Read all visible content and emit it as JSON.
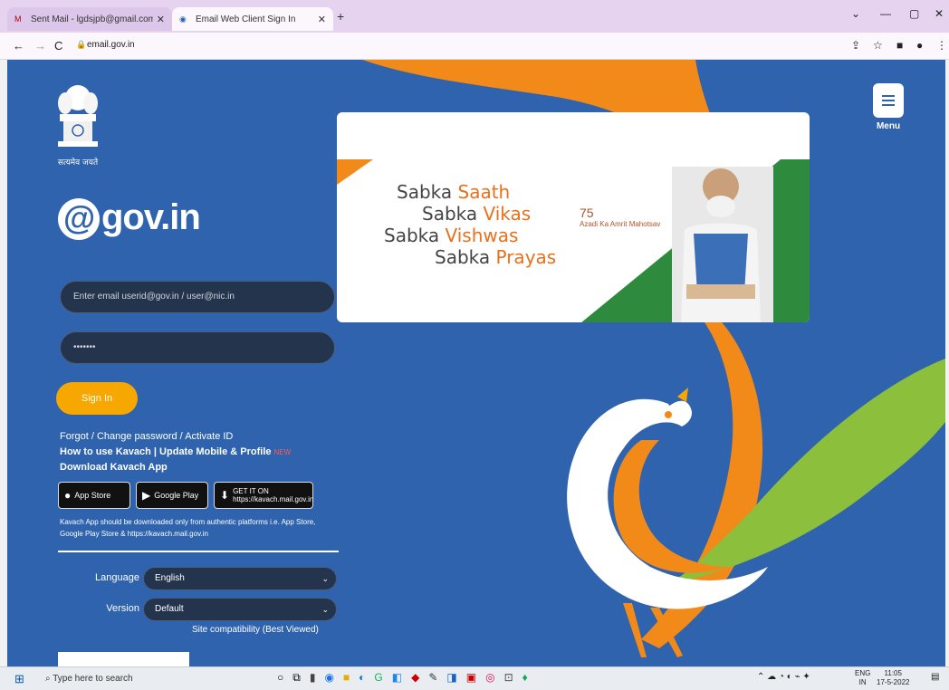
{
  "browser": {
    "tabs": [
      {
        "label": "Sent Mail - lgdsjpb@gmail.com",
        "active": false
      },
      {
        "label": "Email Web Client Sign In",
        "active": true
      }
    ],
    "new_tab": "+",
    "url": "email.gov.in",
    "window_controls": {
      "minimize": "—",
      "maximize": "▢",
      "close": "✕"
    }
  },
  "page": {
    "emblem_text": "सत्यमेव जयते",
    "logo": {
      "at": "@",
      "text": "gov.in"
    },
    "login": {
      "email_placeholder": "Enter email userid@gov.in / user@nic.in",
      "password_mask": "•••••••",
      "signin_label": "Sign In"
    },
    "links": {
      "forgot": "Forgot / Change password / Activate ID",
      "how_to_use": "How to use Kavach",
      "update_mobile": "| Update Mobile & Profile",
      "new_badge": "NEW",
      "download": "Download Kavach App"
    },
    "stores": {
      "app_store": "App Store",
      "google_play": "Google Play",
      "web": "GET IT ON https://kavach.mail.gov.in"
    },
    "notice": "Kavach App should be downloaded only from authentic platforms i.e. App Store, Google Play Store & https://kavach.mail.gov.in",
    "language": {
      "label": "Language",
      "value": "English"
    },
    "version": {
      "label": "Version",
      "value": "Default"
    },
    "compatibility": "Site compatibility (Best Viewed)",
    "menu_label": "Menu",
    "banner": {
      "line1_a": "Sabka ",
      "line1_b": "Saath",
      "line2_a": "Sabka ",
      "line2_b": "Vikas",
      "line3_a": "Sabka ",
      "line3_b": "Vishwas",
      "line4_a": "Sabka ",
      "line4_b": "Prayas",
      "azadi": "Azadi Ka Amrit Mahotsav"
    },
    "colors": {
      "page_bg": "#2f63ad",
      "saffron": "#f28a1a",
      "green": "#8bbf3c",
      "signin": "#f6a800"
    }
  },
  "taskbar": {
    "search_placeholder": "Type here to search",
    "lang": "ENG",
    "lang_sub": "IN",
    "time": "11:05",
    "date": "17-5-2022"
  }
}
